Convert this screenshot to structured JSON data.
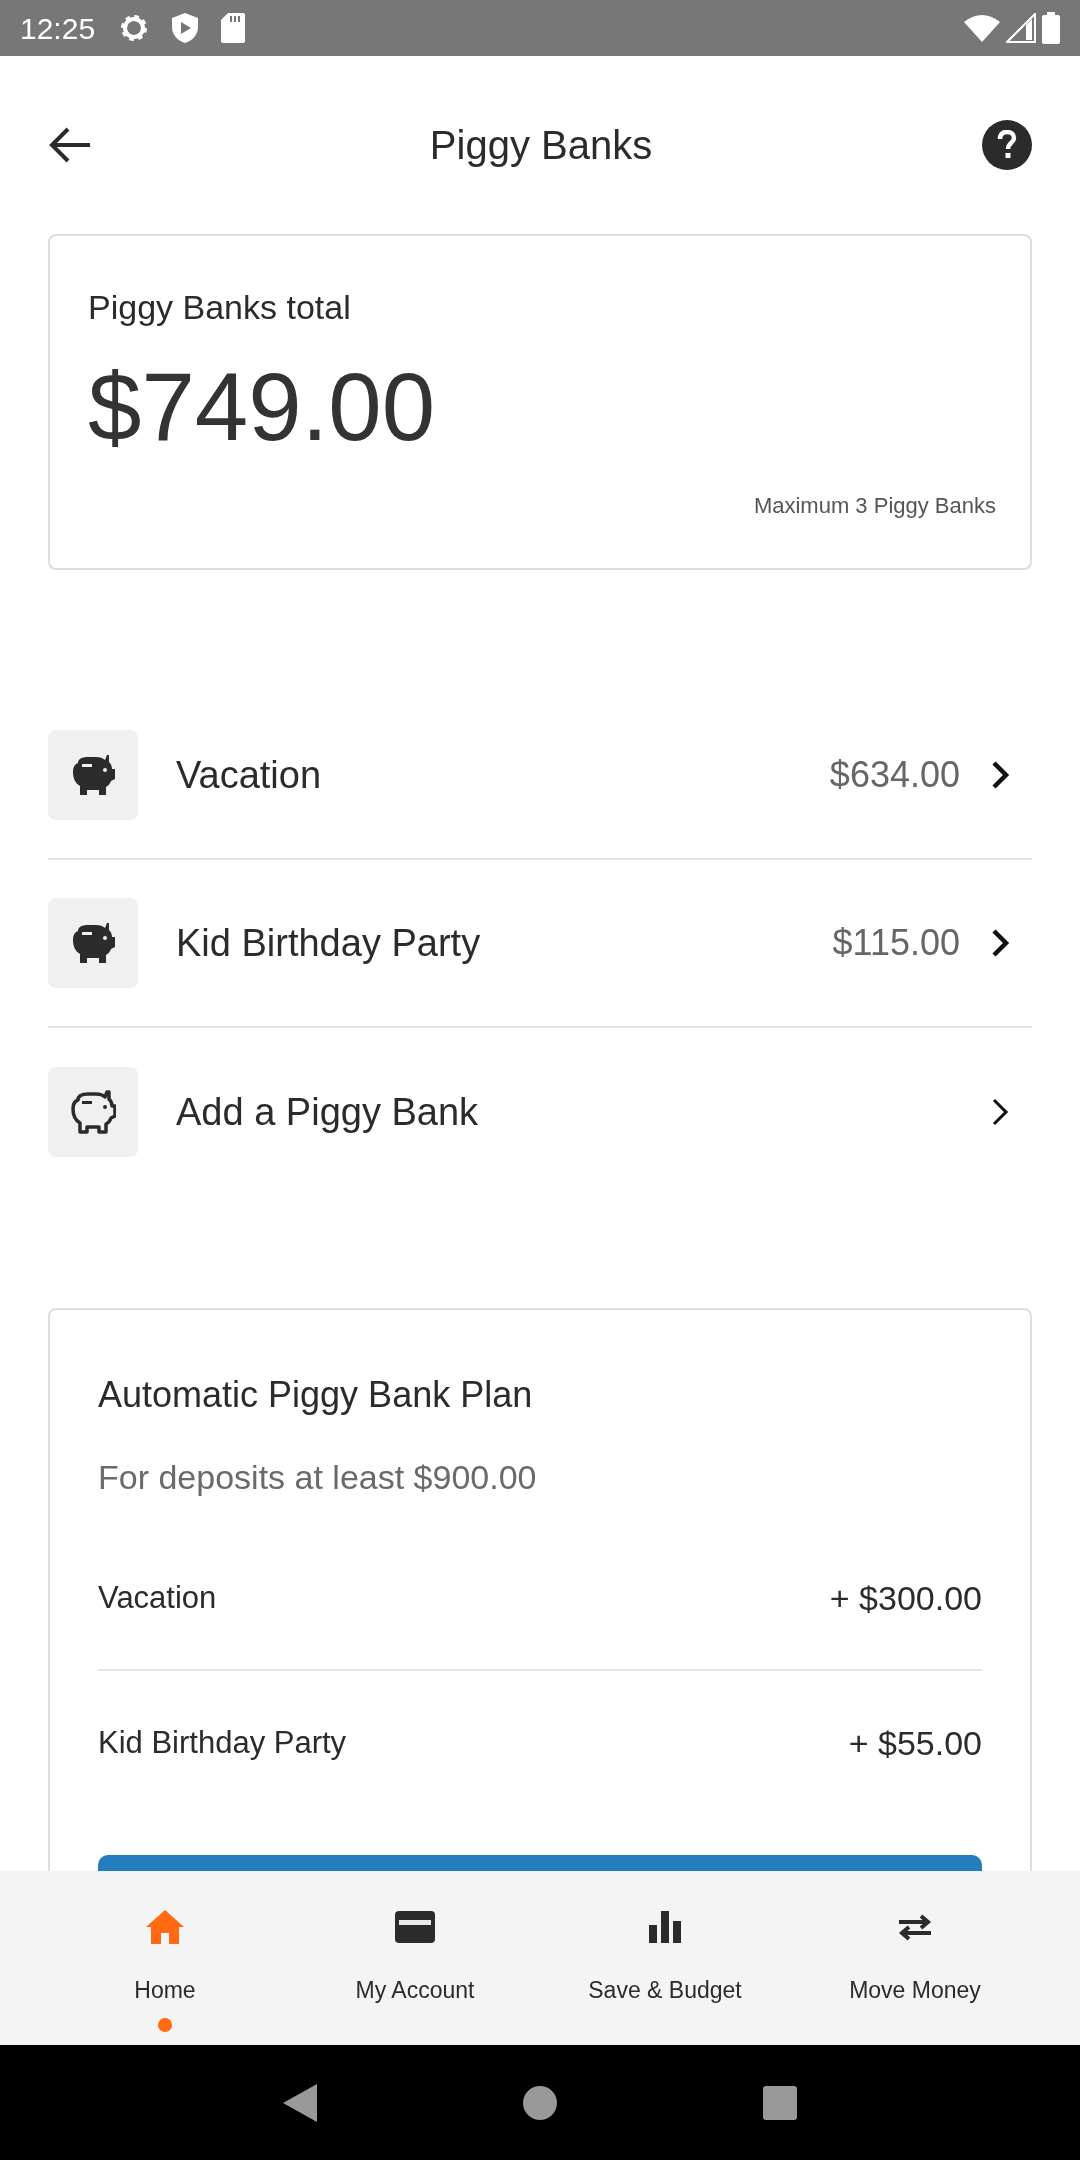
{
  "status_bar": {
    "time": "12:25"
  },
  "header": {
    "title": "Piggy Banks"
  },
  "total_card": {
    "label": "Piggy Banks total",
    "amount": "$749.00",
    "note": "Maximum 3 Piggy Banks"
  },
  "piggy_banks": [
    {
      "kind": "bank",
      "name": "Vacation",
      "amount": "$634.00"
    },
    {
      "kind": "bank",
      "name": "Kid Birthday Party",
      "amount": "$115.00"
    },
    {
      "kind": "add",
      "name": "Add a Piggy Bank"
    }
  ],
  "plan": {
    "title": "Automatic Piggy Bank Plan",
    "subtitle": "For deposits at least $900.00",
    "allocations": [
      {
        "name": "Vacation",
        "amount": "+ $300.00"
      },
      {
        "name": "Kid Birthday Party",
        "amount": "+ $55.00"
      }
    ]
  },
  "bottom_nav": [
    {
      "kind": "home",
      "label": "Home",
      "selected": true
    },
    {
      "kind": "account",
      "label": "My Account",
      "selected": false
    },
    {
      "kind": "budget",
      "label": "Save & Budget",
      "selected": false
    },
    {
      "kind": "transfer",
      "label": "Move Money",
      "selected": false
    }
  ]
}
